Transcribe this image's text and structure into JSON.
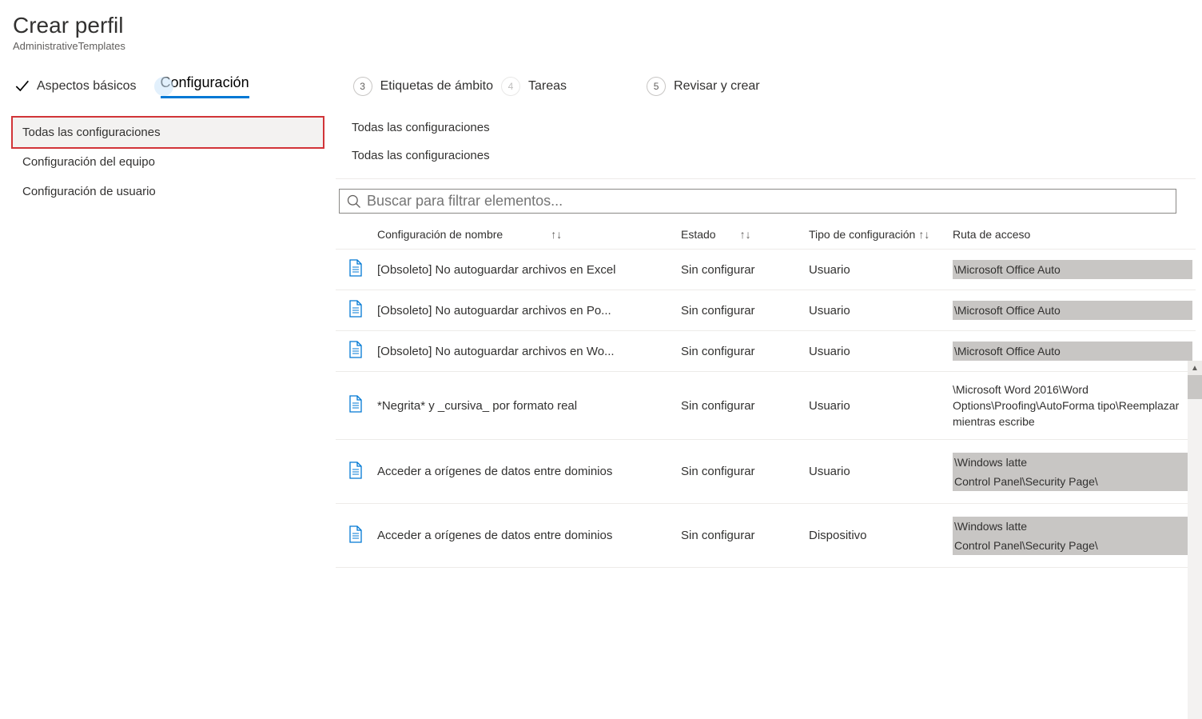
{
  "header": {
    "title": "Crear perfil",
    "subtitle": "AdministrativeTemplates"
  },
  "steps": {
    "s1": "Aspectos básicos",
    "s2": "Configuración",
    "s3n": "3",
    "s3": "Etiquetas de ámbito",
    "s4n": "4",
    "s4": "Tareas",
    "s5n": "5",
    "s5": "Revisar y crear"
  },
  "sidebar": {
    "items": [
      "Todas las configuraciones",
      "Configuración del equipo",
      "Configuración de usuario"
    ]
  },
  "breadcrumb": {
    "a": "Todas las configuraciones",
    "b": "Todas las configuraciones"
  },
  "search": {
    "placeholder": "Buscar para filtrar elementos..."
  },
  "columns": {
    "name": "Configuración de nombre",
    "state": "Estado",
    "type": "Tipo de configuración",
    "path": "Ruta de acceso"
  },
  "rows": [
    {
      "name": "[Obsoleto] No autoguardar archivos en Excel",
      "state": "Sin configurar",
      "type": "Usuario",
      "path": [
        "\\Microsoft Office Auto"
      ]
    },
    {
      "name": "[Obsoleto] No autoguardar archivos en Po...",
      "state": "Sin configurar",
      "type": "Usuario",
      "path": [
        "\\Microsoft Office Auto"
      ]
    },
    {
      "name": "[Obsoleto] No autoguardar archivos en Wo...",
      "state": "Sin configurar",
      "type": "Usuario",
      "path": [
        "\\Microsoft Office Auto"
      ]
    },
    {
      "name": "*Negrita* y _cursiva_ por formato real",
      "state": "Sin configurar",
      "type": "Usuario",
      "path": [
        "\\Microsoft Word 2016\\Word Options\\Proofing\\AutoForma tipo\\Reemplazar mientras escribe"
      ],
      "plain": true
    },
    {
      "name": "Acceder a orígenes de datos entre dominios",
      "state": "Sin configurar",
      "type": "Usuario",
      "path": [
        "\\Windows latte",
        "Control Panel\\Security Page\\"
      ]
    },
    {
      "name": "Acceder a orígenes de datos entre dominios",
      "state": "Sin configurar",
      "type": "Dispositivo",
      "path": [
        "\\Windows latte",
        "Control Panel\\Security Page\\"
      ]
    }
  ]
}
